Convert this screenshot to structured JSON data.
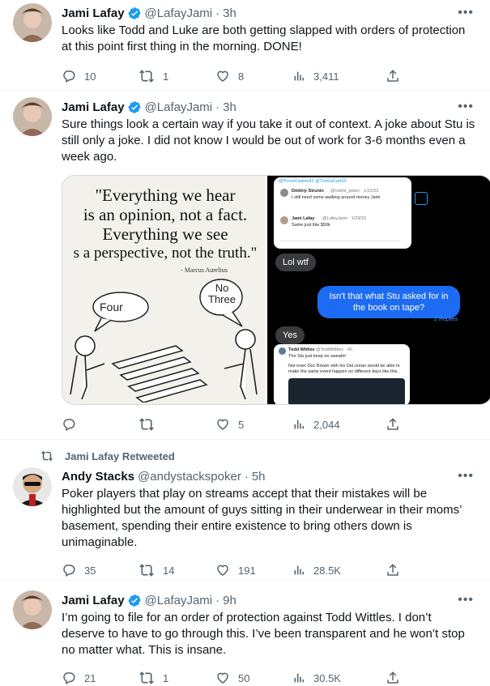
{
  "tweets": [
    {
      "name": "Jami Lafay",
      "handle": "@LafayJami",
      "time": "3h",
      "text": "Looks like Todd and Luke are both getting slapped with orders of protection at this point first thing in the morning. DONE!",
      "replies": "10",
      "retweets": "1",
      "likes": "8",
      "views": "3,411"
    },
    {
      "name": "Jami Lafay",
      "handle": "@LafayJami",
      "time": "3h",
      "text": "Sure things look a certain way if you take it out of context. A joke about Stu is still only a joke. I did not know I would be out of work for 3-6 months even a week ago.",
      "replies": "",
      "retweets": "",
      "likes": "5",
      "views": "2,044",
      "image_quote": {
        "line1": "\"Everything we hear",
        "line2": "is an opinion, not a fact.",
        "line3": "Everything we see",
        "line4": "s a perspective, not the truth.\"",
        "author": "- Marcus Aurelius",
        "bubble_left": "Four",
        "bubble_right": "No Three"
      },
      "image_chat": {
        "header_link": "@PrimeCadets42 @TheEaCarlS0",
        "card1_name": "Dmitriy Strunin",
        "card1_handle": "@rodmi_poker · 1/22/23",
        "card1_text": "I still need some walking around money Jami",
        "card2_name": "Jami Lafay",
        "card2_handle": "@LafayJami · 1/23/23",
        "card2_text": "Same just like $50k",
        "msg1": "Lol wtf",
        "msg2": "Isn't that what Stu asked for in the book on tape?",
        "replies_link": "2 Replies",
        "msg3": "Yes",
        "card3_name": "Todd Wittles",
        "card3_handle": "@ToddWittles · 6h",
        "card3_text1": "The Stu just keep on sweatin'",
        "card3_text2": "Not even Doc Brown with his DeLorean would be able to make the same event happen on different days like this."
      }
    },
    {
      "retweet_label": "Jami Lafay Retweeted",
      "name": "Andy Stacks",
      "handle": "@andystackspoker",
      "time": "5h",
      "text": "Poker players that play on streams accept that their mistakes will be highlighted but the amount of guys sitting in their underwear in their moms’ basement, spending their entire existence to bring others down is unimaginable.",
      "replies": "35",
      "retweets": "14",
      "likes": "191",
      "views": "28.5K"
    },
    {
      "name": "Jami Lafay",
      "handle": "@LafayJami",
      "time": "9h",
      "text": "I’m going to file for an order of protection against Todd Wittles. I don’t deserve to have to go through this. I’ve been transparent and he won’t stop no matter what. This is insane.",
      "replies": "21",
      "retweets": "1",
      "likes": "50",
      "views": "30.5K"
    }
  ],
  "colors": {
    "verified": "#1d9bf0",
    "muted": "#536471",
    "text": "#0f1419",
    "divider": "#eff3f4"
  }
}
